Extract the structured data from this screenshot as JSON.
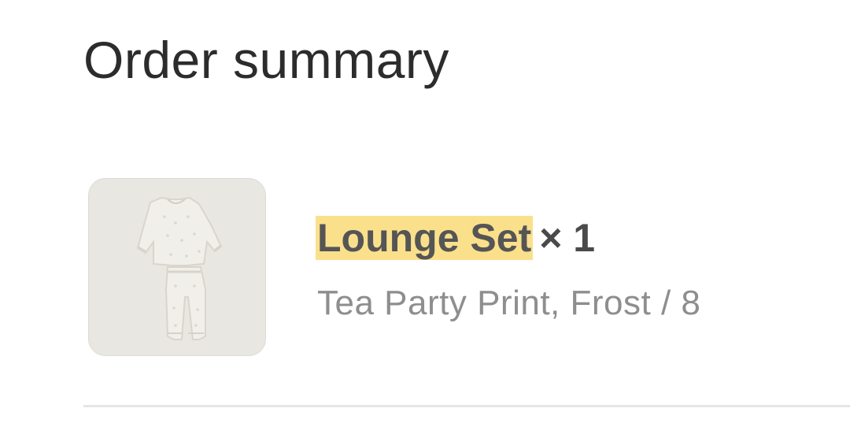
{
  "order_summary": {
    "title": "Order summary",
    "items": [
      {
        "name": "Lounge Set",
        "quantity_text": "× 1",
        "variant": "Tea Party Print, Frost / 8",
        "image_icon": "pajama-set-thumbnail"
      }
    ]
  },
  "colors": {
    "highlight": "#fbe08c",
    "thumbnail_bg": "#e9e7e2",
    "title_text": "#2c2c2c",
    "muted_text": "#8e8e8e",
    "divider": "#e6e6e6"
  }
}
